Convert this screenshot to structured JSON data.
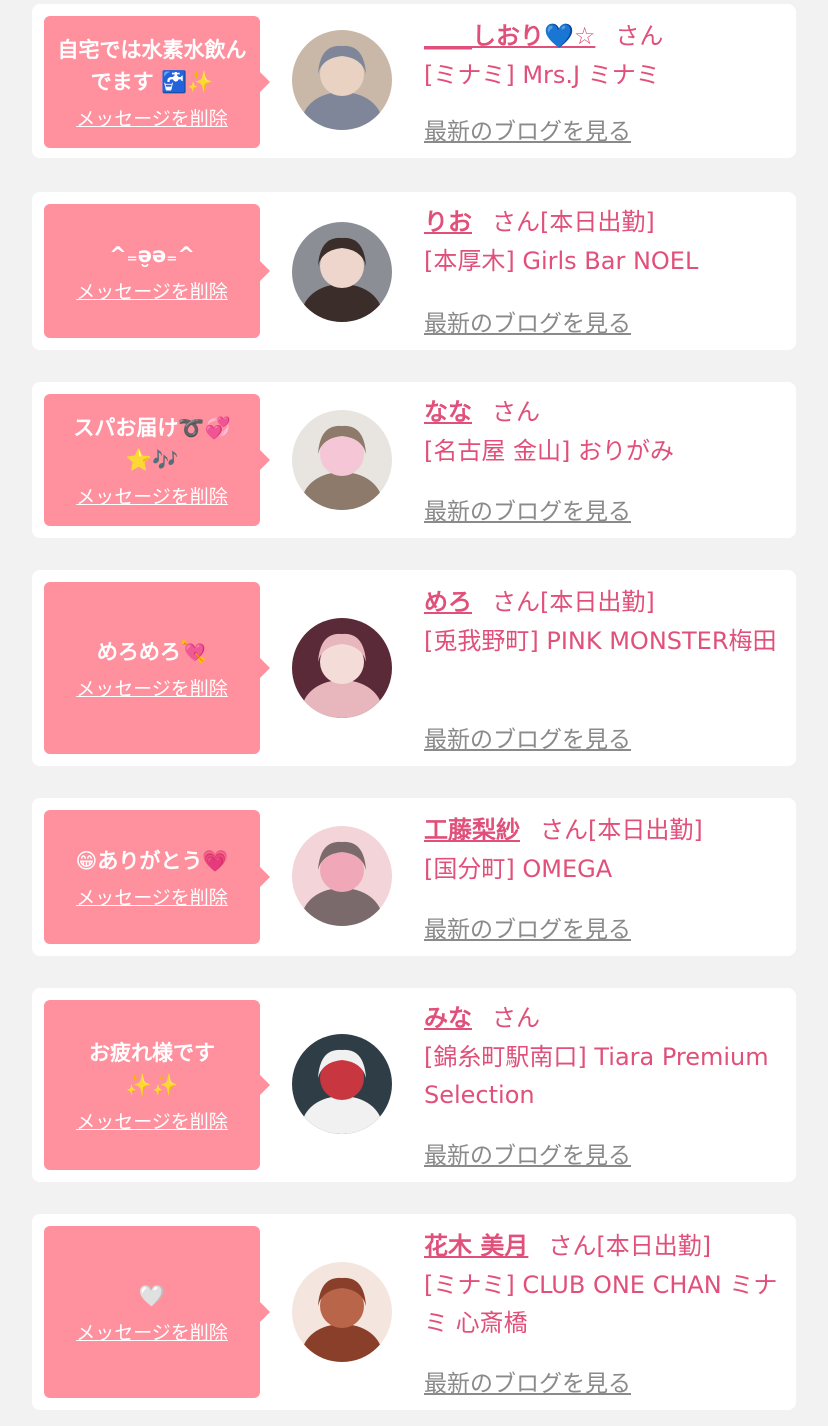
{
  "messages": [
    {
      "bubble_text": "自宅では水素水飲んでます 🚰✨",
      "delete_label": "メッセージを削除",
      "name": "____しおり💙☆",
      "san": "さん",
      "status": "",
      "shop": "[ミナミ] Mrs.J ミナミ",
      "blog_label": "最新のブログを見る",
      "avatar_icon": "portrait-blonde-heart",
      "avatar_colors": [
        "#c9b8a8",
        "#7f8699",
        "#e9d2c2"
      ]
    },
    {
      "bubble_text": "^₌ə̮ə₌^",
      "delete_label": "メッセージを削除",
      "name": "りお",
      "san": "さん",
      "status": "[本日出勤]",
      "shop": "[本厚木] Girls Bar NOEL",
      "blog_label": "最新のブログを見る",
      "avatar_icon": "portrait-bunny-ears",
      "avatar_colors": [
        "#8b8e95",
        "#3a2d2a",
        "#eed6cc"
      ]
    },
    {
      "bubble_text": "スパお届け➰💞\n⭐🎶",
      "delete_label": "メッセージを削除",
      "name": "なな",
      "san": "さん",
      "status": "",
      "shop": "[名古屋 金山] おりがみ",
      "blog_label": "最新のブログを見る",
      "avatar_icon": "portrait-heart-face",
      "avatar_colors": [
        "#e8e4e0",
        "#8d7a6b",
        "#f5c7d6"
      ]
    },
    {
      "bubble_text": "めろめろ💘",
      "delete_label": "メッセージを削除",
      "name": "めろ",
      "san": "さん",
      "status": "[本日出勤]",
      "shop": "[兎我野町] PINK MONSTER梅田",
      "blog_label": "最新のブログを見る",
      "avatar_icon": "portrait-pink-bunny",
      "avatar_colors": [
        "#5a2a38",
        "#e7b7bd",
        "#f4ddd9"
      ]
    },
    {
      "bubble_text": "😁ありがとう💗",
      "delete_label": "メッセージを削除",
      "name": "工藤梨紗",
      "san": "さん",
      "status": "[本日出勤]",
      "shop": "[国分町] OMEGA",
      "blog_label": "最新のブログを見る",
      "avatar_icon": "portrait-pink-sticker",
      "avatar_colors": [
        "#f3d4d8",
        "#7b6a6c",
        "#f0a8b8"
      ]
    },
    {
      "bubble_text": "お疲れ様です\n✨✨",
      "delete_label": "メッセージを削除",
      "name": "みな",
      "san": "さん",
      "status": "",
      "shop": "[錦糸町駅南口] Tiara Premium Selection",
      "blog_label": "最新のブログを見る",
      "avatar_icon": "portrait-christmas",
      "avatar_colors": [
        "#2f3e46",
        "#f1f1f1",
        "#c8373f"
      ]
    },
    {
      "bubble_text": "🤍",
      "delete_label": "メッセージを削除",
      "name": "花木 美月",
      "san": "さん",
      "status": "[本日出勤]",
      "shop": "[ミナミ] CLUB ONE CHAN ミナミ 心斎橋",
      "blog_label": "最新のブログを見る",
      "avatar_icon": "portrait-hair-back",
      "avatar_colors": [
        "#f4e6de",
        "#8a3f2a",
        "#b8654a"
      ]
    }
  ]
}
